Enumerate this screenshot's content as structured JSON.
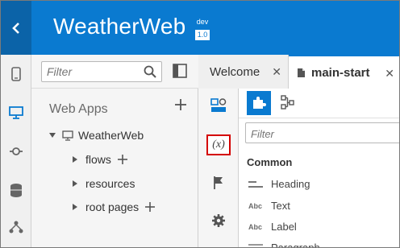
{
  "header": {
    "app_title": "WeatherWeb",
    "badge_top": "dev",
    "badge_bottom": "1.0",
    "colors": {
      "header": "#0a7ad0",
      "back": "#0b63a8"
    }
  },
  "rail": {
    "icons": [
      "phone-icon",
      "desktop-icon",
      "service-icon",
      "database-icon",
      "process-icon"
    ]
  },
  "navigator": {
    "filter_placeholder": "Filter",
    "section_title": "Web Apps",
    "tree": {
      "root": "WeatherWeb",
      "children": [
        "flows",
        "resources",
        "root pages"
      ]
    }
  },
  "tabs": [
    {
      "label": "Welcome",
      "close": "✕"
    },
    {
      "label": "main-start",
      "close": "✕"
    }
  ],
  "properties": {
    "variables_label": "(x)"
  },
  "palette": {
    "filter_placeholder": "Filter",
    "category": "Common",
    "components": [
      {
        "label": "Heading",
        "icon": "heading-icon"
      },
      {
        "label": "Text",
        "icon": "abc-icon",
        "icon_text": "Abc"
      },
      {
        "label": "Label",
        "icon": "abc-icon",
        "icon_text": "Abc"
      },
      {
        "label": "Paragraph",
        "icon": "paragraph-icon"
      }
    ]
  }
}
